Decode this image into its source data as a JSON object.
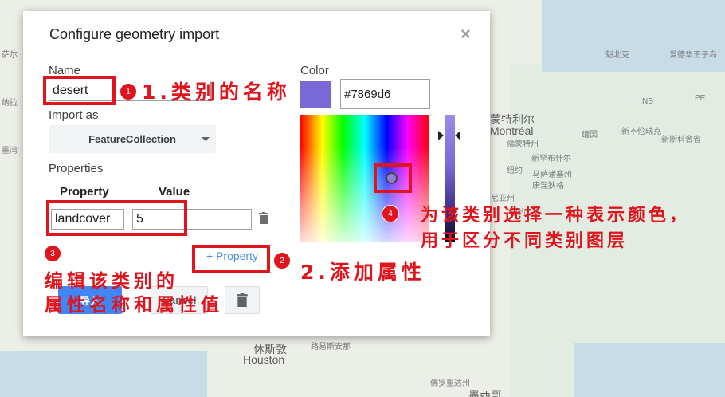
{
  "map": {
    "labels": [
      "蒙特利尔",
      "Montréal",
      "缅因",
      "佛蒙特州",
      "新罕布什尔",
      "纽约",
      "马萨诸塞州",
      "康涅狄格",
      "尼亚州",
      "纽约",
      "休斯敦",
      "Houston",
      "路易斯安那",
      "佛罗里达州",
      "墨西哥",
      "魁北克",
      "NB",
      "PE",
      "新不伦瑞克",
      "新斯科舍省",
      "爱德华王子岛",
      "纳拉",
      "墨湾",
      "萨尔"
    ]
  },
  "dialog": {
    "title": "Configure geometry import",
    "close_glyph": "×",
    "name_label": "Name",
    "name_value": "desert",
    "import_as_label": "Import as",
    "import_as_value": "FeatureCollection",
    "properties_label": "Properties",
    "property_header": "Property",
    "value_header": "Value",
    "property_name": "landcover",
    "property_value": "5",
    "add_property": "+ Property",
    "ok_label": "导入",
    "cancel_label": "Cancel",
    "color_label": "Color",
    "color_hex": "#7869d6"
  },
  "annotations": {
    "badge1": "1",
    "badge2": "2",
    "badge3": "3",
    "badge4": "4",
    "note1": "1.类别的名称",
    "note2": "2.添加属性",
    "note3_line1": "编辑该类别的",
    "note3_line2": "属性名称和属性值",
    "note4_line1": "为该类别选择一种表示颜色，",
    "note4_line2": "用于区分不同类别图层"
  },
  "colors": {
    "accent_red": "#e0141c",
    "chosen_color": "#7869d6",
    "link_blue": "#4a90d9"
  },
  "icons": [
    "close-icon",
    "trash-icon",
    "caret-down-icon"
  ]
}
